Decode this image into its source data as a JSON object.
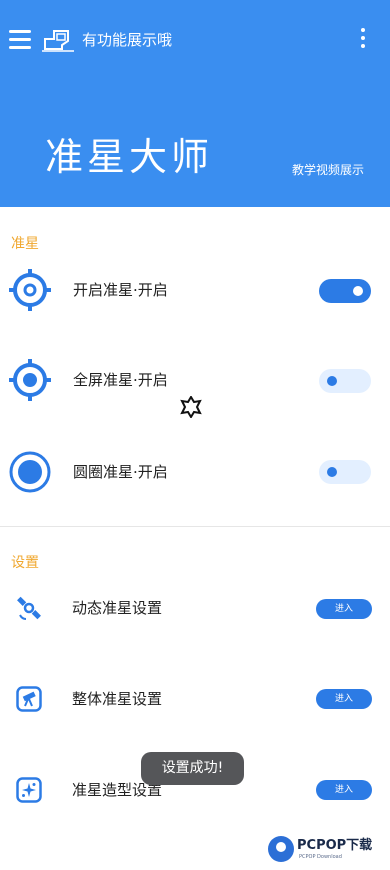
{
  "header": {
    "top_label": "有功能展示哦",
    "app_title": "准星大师",
    "tutorial_link": "教学视频展示",
    "menu_icon": "hamburger-menu-icon",
    "more_icon": "more-vertical-icon",
    "logo_icon": "device-logo-icon"
  },
  "crosshair_section": {
    "title": "准星",
    "items": [
      {
        "label": "开启准星·开启",
        "icon": "crosshair-ring-icon",
        "toggle_on": true
      },
      {
        "label": "全屏准星·开启",
        "icon": "crosshair-dot-icon",
        "toggle_on": false
      },
      {
        "label": "圆圈准星·开启",
        "icon": "circle-dot-icon",
        "toggle_on": false
      }
    ]
  },
  "settings_section": {
    "title": "设置",
    "items": [
      {
        "label": "动态准星设置",
        "icon": "satellite-icon",
        "button": "进入"
      },
      {
        "label": "整体准星设置",
        "icon": "telescope-icon",
        "button": "进入"
      },
      {
        "label": "准星造型设置",
        "icon": "sparkle-icon",
        "button": "进入"
      }
    ]
  },
  "toast": "设置成功!",
  "watermark": {
    "text": "PCPOP下载",
    "sub": "PCPOP Download"
  },
  "colors": {
    "header_bg": "#3a8ef0",
    "accent": "#2c7be5",
    "section_title": "#f0a830"
  }
}
